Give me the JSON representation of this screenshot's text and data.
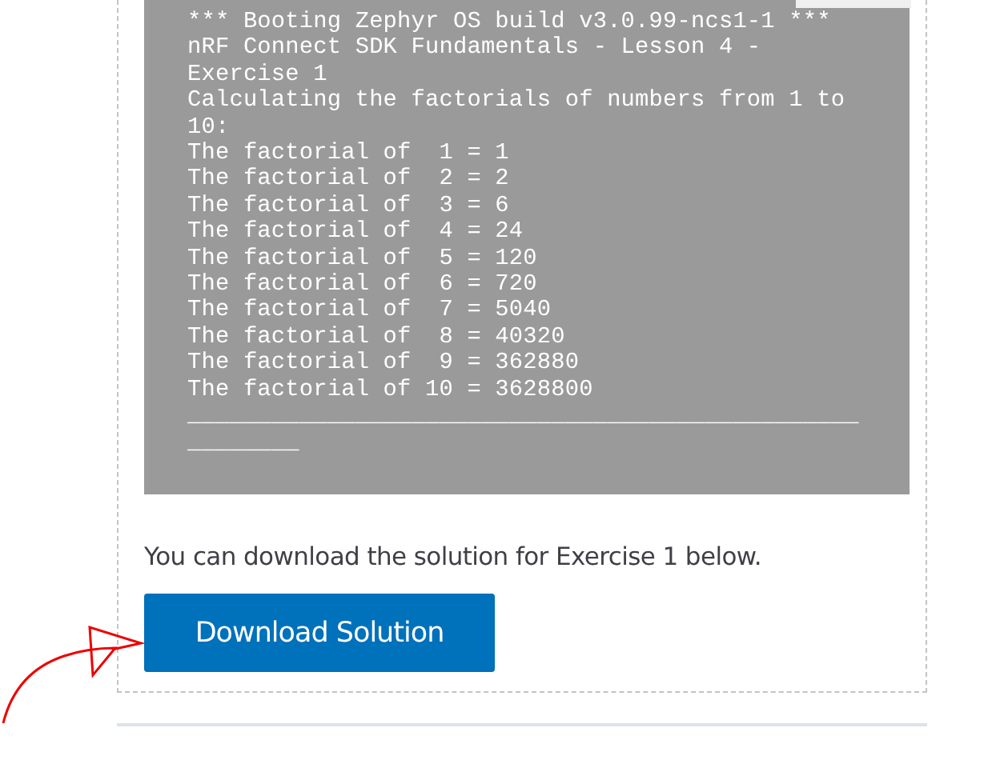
{
  "terminal": {
    "lines": [
      "*** Booting Zephyr OS build v3.0.99-ncs1-1 ***",
      "nRF Connect SDK Fundamentals - Lesson 4 -",
      "Exercise 1",
      "Calculating the factorials of numbers from 1 to",
      "10:",
      "The factorial of  1 = 1",
      "The factorial of  2 = 2",
      "The factorial of  3 = 6",
      "The factorial of  4 = 24",
      "The factorial of  5 = 120",
      "The factorial of  6 = 720",
      "The factorial of  7 = 5040",
      "The factorial of  8 = 40320",
      "The factorial of  9 = 362880",
      "The factorial of 10 = 3628800",
      "________________________________________________",
      "________"
    ]
  },
  "text": "You can download the solution for Exercise 1 below.",
  "button": "Download Solution"
}
